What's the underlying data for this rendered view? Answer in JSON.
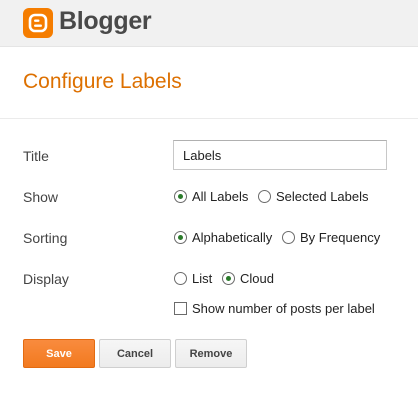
{
  "header": {
    "brand": "Blogger",
    "icon": "blogger-logo-icon",
    "brand_color": "#f57d00"
  },
  "page": {
    "title": "Configure Labels",
    "title_color": "#dd7000"
  },
  "form": {
    "title": {
      "label": "Title",
      "value": "Labels"
    },
    "show": {
      "label": "Show",
      "options": [
        "All Labels",
        "Selected Labels"
      ],
      "selected": "All Labels"
    },
    "sorting": {
      "label": "Sorting",
      "options": [
        "Alphabetically",
        "By Frequency"
      ],
      "selected": "Alphabetically"
    },
    "display": {
      "label": "Display",
      "options": [
        "List",
        "Cloud"
      ],
      "selected": "Cloud"
    },
    "show_count": {
      "label": "Show number of posts per label",
      "checked": false
    }
  },
  "buttons": {
    "save": "Save",
    "cancel": "Cancel",
    "remove": "Remove",
    "save_color": "#f57d00"
  }
}
